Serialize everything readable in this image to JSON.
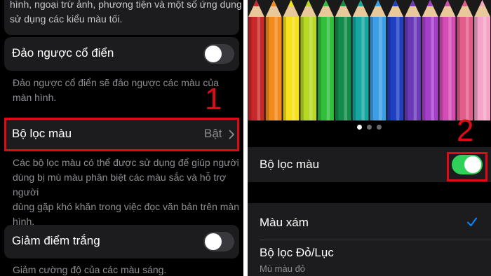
{
  "left": {
    "top_desc": [
      "hình, ngoại trừ ảnh, phương tiện và một số ứng dụng",
      "sử dụng các kiểu màu tối."
    ],
    "classic_invert": {
      "label": "Đảo ngược cổ điển",
      "enabled": false,
      "footer": [
        "Đảo ngược cổ điển sẽ đảo ngược các màu của",
        "màn hình."
      ]
    },
    "color_filter": {
      "label": "Bộ lọc màu",
      "value": "Bật",
      "footer": [
        "Các bộ lọc màu có thể được sử dụng để giúp người",
        "dùng bị mù màu phân biệt các màu sắc và hỗ trợ người",
        "dùng gặp khó khăn trong việc đọc văn bản trên màn",
        "hình."
      ]
    },
    "reduce_white": {
      "label": "Giảm điểm trắng",
      "enabled": false,
      "footer": "Giảm cường độ của các màu sáng."
    },
    "step_number": "1"
  },
  "right": {
    "pencil_colors": [
      "#c8282a",
      "#f28a1c",
      "#f7e11a",
      "#b7d825",
      "#2fbf3a",
      "#128c4a",
      "#16a7a1",
      "#3b9ee6",
      "#1f3fc4",
      "#6b3ab8",
      "#a43fc9",
      "#d34cb4",
      "#e45d8a",
      "#f6a3c9"
    ],
    "page_dots": 3,
    "active_dot": 0,
    "color_filter": {
      "label": "Bộ lọc màu",
      "enabled": true
    },
    "options": [
      {
        "label": "Màu xám",
        "selected": true
      },
      {
        "label": "Bộ lọc Đỏ/Lục",
        "sublabel": "Mù màu đỏ",
        "selected": false
      }
    ],
    "step_number": "2"
  },
  "colors": {
    "highlight": "#e10a14",
    "toggle_on": "#30d158",
    "checkmark": "#0a84ff",
    "cell_bg": "#1c1c1e"
  },
  "icons": {
    "chevron": "chevron-right-icon",
    "check": "checkmark-icon"
  }
}
